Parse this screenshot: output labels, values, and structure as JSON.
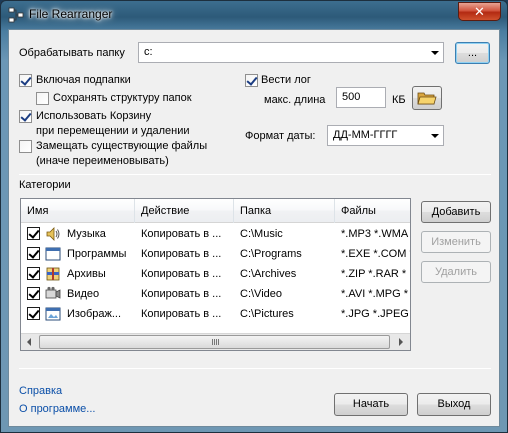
{
  "window": {
    "title": "File Rearranger",
    "close_label": "✕"
  },
  "folder": {
    "label": "Обрабатывать папку",
    "value": "c:",
    "browse_label": "..."
  },
  "options": {
    "include_subfolders": {
      "label": "Включая подпапки",
      "checked": true
    },
    "keep_structure": {
      "label": "Сохранять структуру папок",
      "checked": false
    },
    "use_recycle": {
      "label_line1": "Использовать Корзину",
      "label_line2": "при перемещении и удалении",
      "checked": true
    },
    "replace_existing": {
      "label_line1": "Замещать существующие файлы",
      "label_line2": "(иначе переименовывать)",
      "checked": false
    }
  },
  "log": {
    "label": "Вести лог",
    "checked": true,
    "max_length_label": "макс. длина",
    "max_length_value": "500",
    "unit": "КБ"
  },
  "date_format": {
    "label": "Формат даты:",
    "value": "ДД-ММ-ГГГГ"
  },
  "categories": {
    "label": "Категории",
    "columns": [
      "Имя",
      "Действие",
      "Папка",
      "Файлы"
    ],
    "rows": [
      {
        "checked": true,
        "icon": "music-icon",
        "name": "Музыка",
        "action": "Копировать в ...",
        "folder": "C:\\Music",
        "files": "*.MP3 *.WMA"
      },
      {
        "checked": true,
        "icon": "program-window-icon",
        "name": "Программы",
        "action": "Копировать в ...",
        "folder": "C:\\Programs",
        "files": "*.EXE *.COM *"
      },
      {
        "checked": true,
        "icon": "archive-icon",
        "name": "Архивы",
        "action": "Копировать в ...",
        "folder": "C:\\Archives",
        "files": "*.ZIP *.RAR *"
      },
      {
        "checked": true,
        "icon": "video-icon",
        "name": "Видео",
        "action": "Копировать в ...",
        "folder": "C:\\Video",
        "files": "*.AVI *.MPG *"
      },
      {
        "checked": true,
        "icon": "image-icon",
        "name": "Изображ...",
        "action": "Копировать в ...",
        "folder": "C:\\Pictures",
        "files": "*.JPG *.JPEG"
      }
    ],
    "add_label": "Добавить",
    "edit_label": "Изменить",
    "delete_label": "Удалить"
  },
  "footer": {
    "help_link": "Справка",
    "about_link": "О программе...",
    "start_label": "Начать",
    "exit_label": "Выход"
  }
}
